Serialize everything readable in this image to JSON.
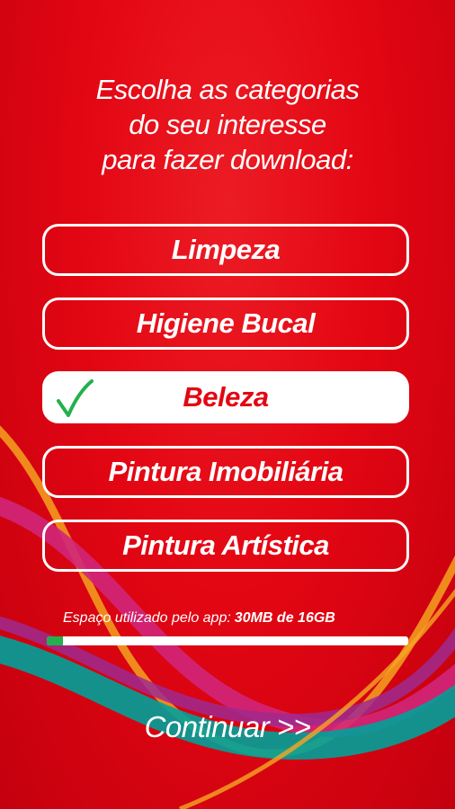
{
  "title_lines": [
    "Escolha as categorias",
    "do seu interesse",
    "para fazer download:"
  ],
  "categories": [
    {
      "label": "Limpeza",
      "selected": false
    },
    {
      "label": "Higiene Bucal",
      "selected": false
    },
    {
      "label": "Beleza",
      "selected": true
    },
    {
      "label": "Pintura Imobiliária",
      "selected": false
    },
    {
      "label": "Pintura Artística",
      "selected": false
    }
  ],
  "storage": {
    "label": "Espaço utilizado pelo app:",
    "value": "30MB de 16GB",
    "progress_fraction": 0.045
  },
  "continue_label": "Continuar >>",
  "colors": {
    "background": "#e30613",
    "selected_text": "#e30613",
    "check": "#22b14c",
    "progress": "#22b14c"
  },
  "icons": {
    "selected_marker": "checkmark-icon"
  }
}
